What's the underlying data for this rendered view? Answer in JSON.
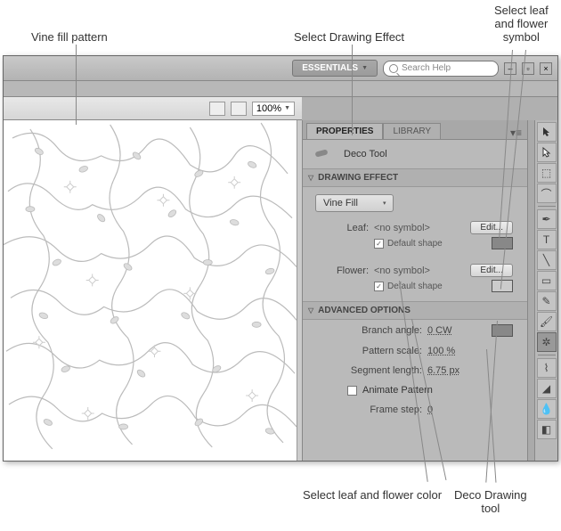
{
  "annotations": {
    "vine_fill": "Vine fill pattern",
    "select_effect": "Select Drawing Effect",
    "select_symbol": "Select leaf\nand flower\nsymbol",
    "select_color": "Select leaf and flower color",
    "deco_tool": "Deco Drawing\ntool"
  },
  "toolbar": {
    "workspace": "ESSENTIALS",
    "search_placeholder": "Search Help",
    "zoom": "100%"
  },
  "panel": {
    "tabs": {
      "properties": "PROPERTIES",
      "library": "LIBRARY"
    },
    "tool_name": "Deco Tool",
    "sections": {
      "drawing_effect": "DRAWING EFFECT",
      "advanced_options": "ADVANCED OPTIONS"
    },
    "effect_select": "Vine Fill",
    "leaf": {
      "label": "Leaf:",
      "value": "<no symbol>",
      "edit": "Edit...",
      "default": "Default shape"
    },
    "flower": {
      "label": "Flower:",
      "value": "<no symbol>",
      "edit": "Edit...",
      "default": "Default shape"
    },
    "advanced": {
      "branch_angle_label": "Branch angle:",
      "branch_angle_value": "0 CW",
      "pattern_scale_label": "Pattern scale:",
      "pattern_scale_value": "100 %",
      "segment_length_label": "Segment length:",
      "segment_length_value": "6.75 px",
      "animate_label": "Animate Pattern",
      "frame_step_label": "Frame step:",
      "frame_step_value": "0"
    }
  },
  "colors": {
    "swatch_dark": "#888888",
    "swatch_light": "#cccccc"
  }
}
